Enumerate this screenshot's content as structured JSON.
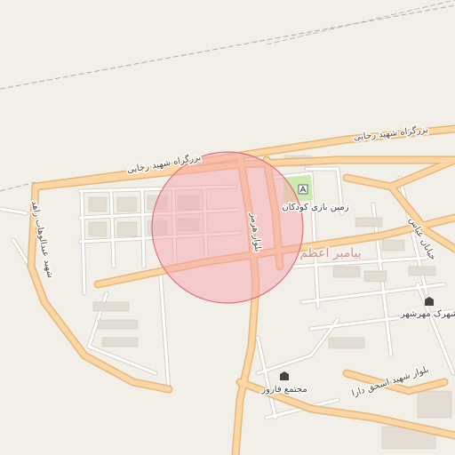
{
  "map": {
    "colors": {
      "background": "#f2efe9",
      "major_road": "#fcd6a4",
      "major_road_casing": "#e7b87a",
      "minor_road": "#ffffff",
      "minor_road_casing": "#d6cfc6",
      "park": "#cdebb0",
      "railway": "#b5b0aa",
      "highlight_circle_fill": "#f5a5ad",
      "highlight_circle_stroke": "#e0707d"
    },
    "labels": {
      "highway_top": "بزرگراه شهید رجایی",
      "highway_left": "بزرگراه شهید رجایی",
      "boulevard_hormoz": "بلوار هرمز",
      "street_left": "شهید عبدالوهاب زاهد",
      "street_abbas": "خیابان عباس",
      "neighborhood": "پیامبر اعظم",
      "playground": "زمین بازی کودکان",
      "shahrak_mehrshahr": "شهرک مهرشهر",
      "mojtama_farvar": "مجتمع فارور",
      "boulevard_ishaq": "بلوار شهید اسحق دارا"
    },
    "icons": {
      "playground": "playground-icon",
      "shahrak_mehrshahr": "building-icon",
      "mojtama_farvar": "building-icon"
    },
    "highlight": {
      "shape": "circle"
    }
  }
}
